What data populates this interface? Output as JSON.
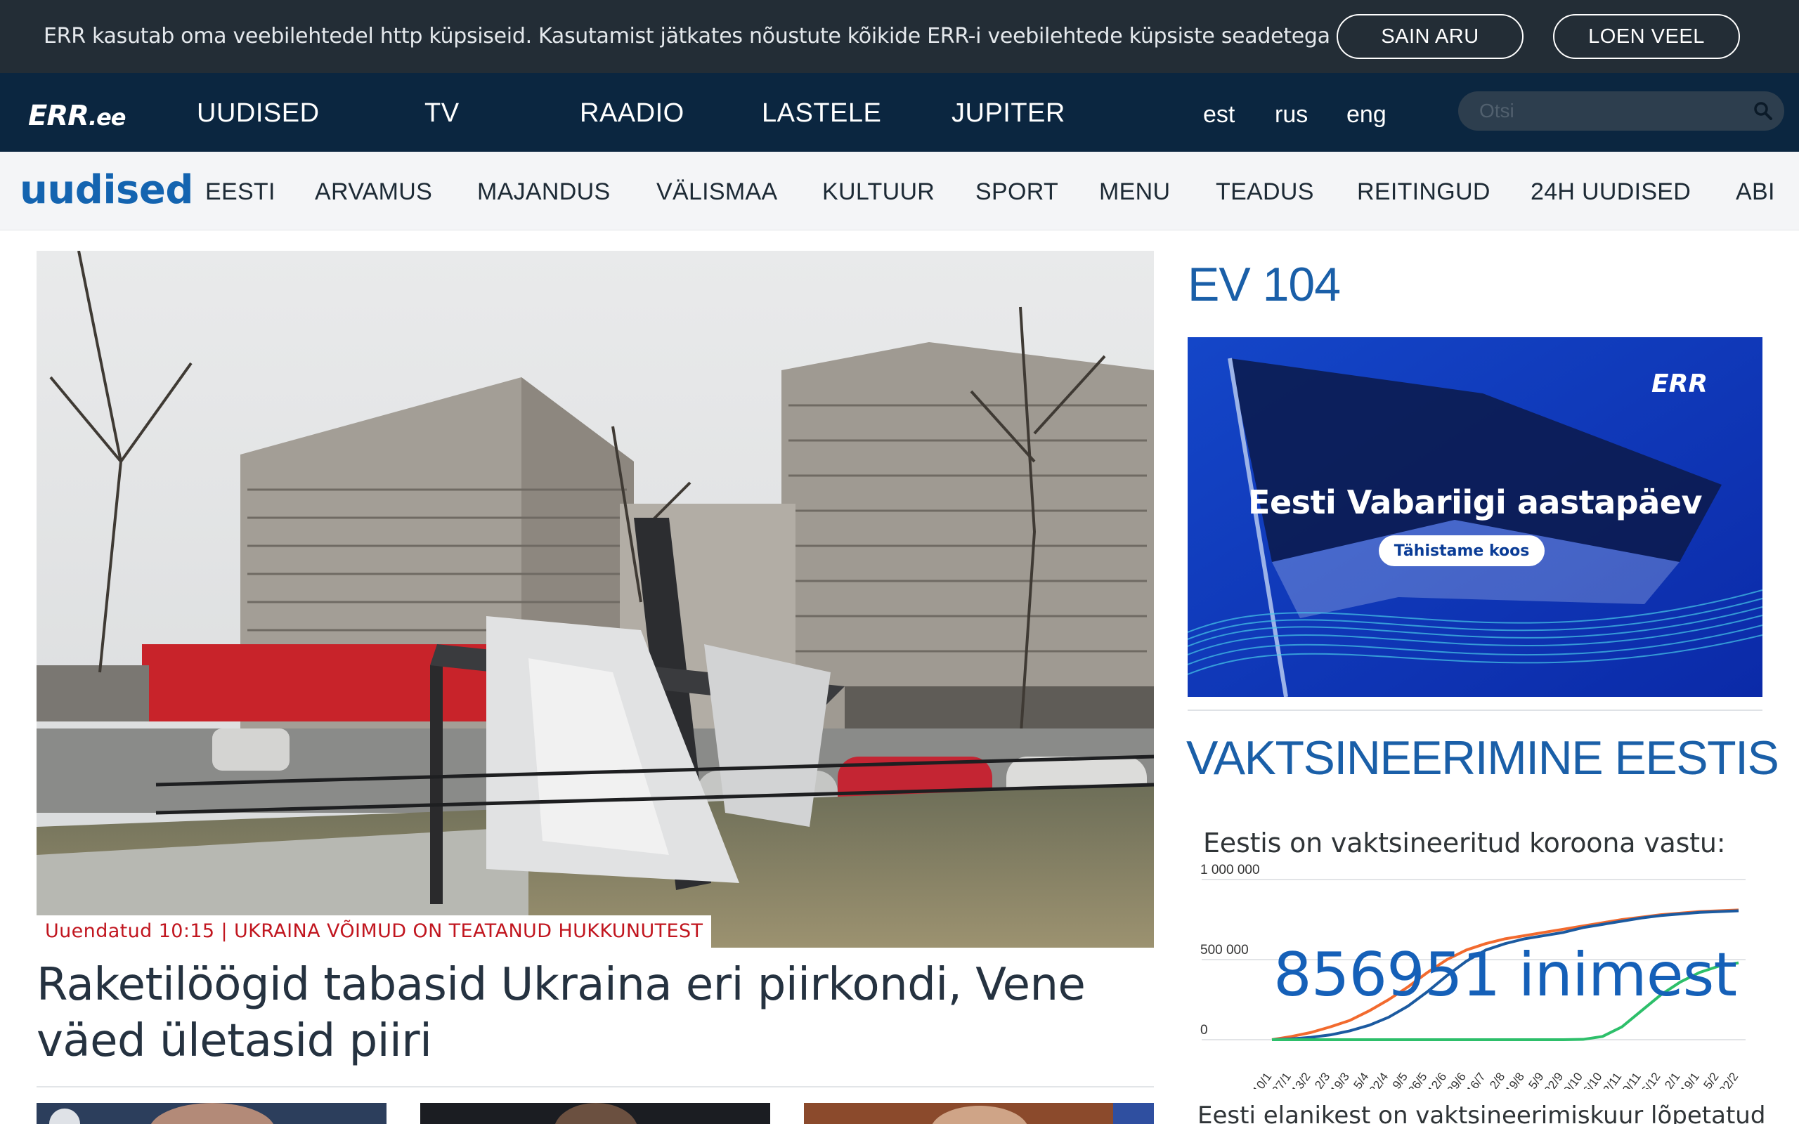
{
  "cookie": {
    "text": "ERR kasutab oma veebilehtedel http küpsiseid. Kasutamist jätkates nõustute kõikide ERR-i veebilehtede küpsiste seadetega",
    "ok_label": "SAIN ARU",
    "more_label": "LOEN VEEL"
  },
  "topnav": {
    "logo": "ERR",
    "logo_suffix": ".ee",
    "items": [
      "UUDISED",
      "TV",
      "RAADIO",
      "LASTELE",
      "JUPITER"
    ],
    "langs": [
      "est",
      "rus",
      "eng"
    ],
    "search_placeholder": "Otsi"
  },
  "subnav": {
    "brand": "uudised",
    "items": [
      "EESTI",
      "ARVAMUS",
      "MAJANDUS",
      "VÄLISMAA",
      "KULTUUR",
      "SPORT",
      "MENU",
      "TEADUS",
      "REITINGUD",
      "24H UUDISED",
      "ABI"
    ]
  },
  "hero": {
    "tag": "Uuendatud 10:15 | UKRAINA VÕIMUD ON TEATANUD HUKKUNUTEST",
    "headline": "Raketilöögid tabasid Ukraina eri piirkondi, Vene väed ületasid piiri"
  },
  "sidebar": {
    "ev_title": "EV 104",
    "banner": {
      "logo": "ERR",
      "title": "Eesti Vabariigi aastapäev",
      "button": "Tähistame koos"
    },
    "vacc_title": "VAKTSINEERIMINE EESTIS",
    "vacc_sub": "Eestis on vaktsineeritud koroona vastu:",
    "big_number": "856951 inimest",
    "footer": "Eesti elanikest on vaktsineerimiskuur lõpetatud"
  },
  "colors": {
    "cookie_bg": "#232d36",
    "nav_bg": "#0b2640",
    "subnav_bg": "#f4f5f7",
    "accent_blue": "#1a5fa8",
    "tag_red": "#c1161f"
  },
  "chart_data": {
    "type": "line",
    "title": "",
    "xlabel": "",
    "ylabel": "",
    "y_ticks": [
      "1 000 000",
      "500 000",
      "0"
    ],
    "ylim": [
      0,
      1000000
    ],
    "categories": [
      "10/1",
      "27/1",
      "13/2",
      "2/3",
      "19/3",
      "5/4",
      "22/4",
      "9/5",
      "26/5",
      "12/6",
      "29/6",
      "16/7",
      "2/8",
      "19/8",
      "5/9",
      "22/9",
      "9/10",
      "26/10",
      "12/11",
      "29/11",
      "16/12",
      "2/1",
      "19/1",
      "5/2",
      "22/2"
    ],
    "series": [
      {
        "color": "#f26a2e",
        "values": [
          0,
          20000,
          45000,
          80000,
          120000,
          180000,
          250000,
          330000,
          420000,
          500000,
          560000,
          600000,
          630000,
          650000,
          670000,
          690000,
          710000,
          730000,
          750000,
          765000,
          780000,
          790000,
          800000,
          805000,
          810000
        ]
      },
      {
        "color": "#1b5aa0",
        "values": [
          0,
          5000,
          15000,
          30000,
          55000,
          90000,
          140000,
          210000,
          300000,
          400000,
          490000,
          560000,
          600000,
          630000,
          650000,
          670000,
          700000,
          720000,
          740000,
          760000,
          775000,
          785000,
          795000,
          800000,
          805000
        ]
      },
      {
        "color": "#2dbf6a",
        "values": [
          0,
          0,
          0,
          0,
          0,
          0,
          0,
          0,
          0,
          0,
          0,
          0,
          0,
          0,
          0,
          0,
          2000,
          20000,
          80000,
          180000,
          280000,
          360000,
          420000,
          460000,
          480000
        ]
      }
    ]
  }
}
